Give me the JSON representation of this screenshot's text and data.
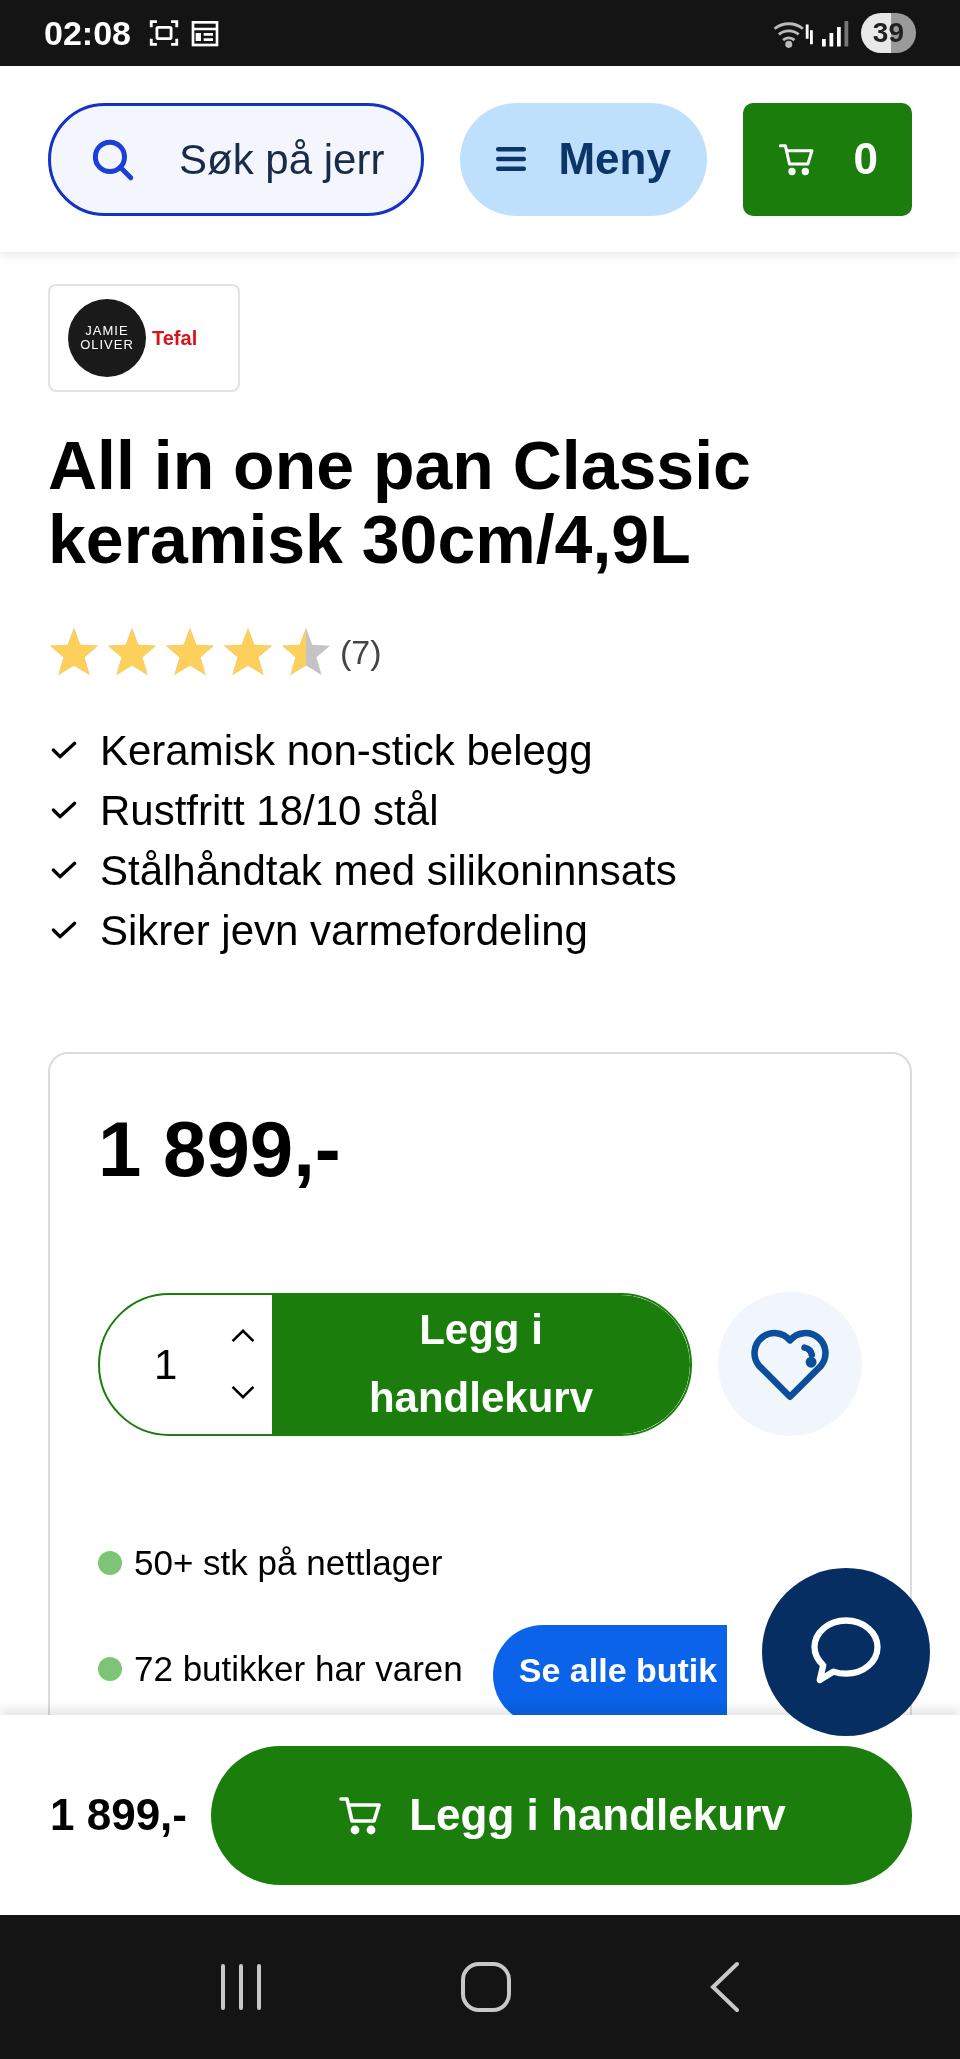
{
  "status_bar": {
    "time": "02:08",
    "battery": "39"
  },
  "header": {
    "search": {
      "placeholder": "Søk på jerr"
    },
    "menu": "Meny",
    "cart_count": "0"
  },
  "product": {
    "brand_logo": {
      "primary": [
        "JAMIE",
        "OLIVER"
      ],
      "secondary": "Tefal"
    },
    "title": "All in one pan Classic keramisk 30cm/4,9L",
    "rating": {
      "stars": 4.5,
      "count": "(7)"
    },
    "features": [
      "Keramisk non-stick belegg",
      "Rustfritt 18/10 stål",
      "Stålhåndtak med silikoninnsats",
      "Sikrer jevn varmefordeling"
    ]
  },
  "buy_box": {
    "price": "1 899,-",
    "quantity": "1",
    "add_button": "Legg i handlekurv",
    "stock": [
      {
        "text": "50+ stk på nettlager",
        "color": "#7cc576"
      },
      {
        "text": "72 butikker har varen",
        "color": "#7cc576"
      }
    ],
    "stores_button": "Se alle butik"
  },
  "sticky_bar": {
    "price": "1 899,-",
    "add_button": "Legg i handlekurv"
  }
}
